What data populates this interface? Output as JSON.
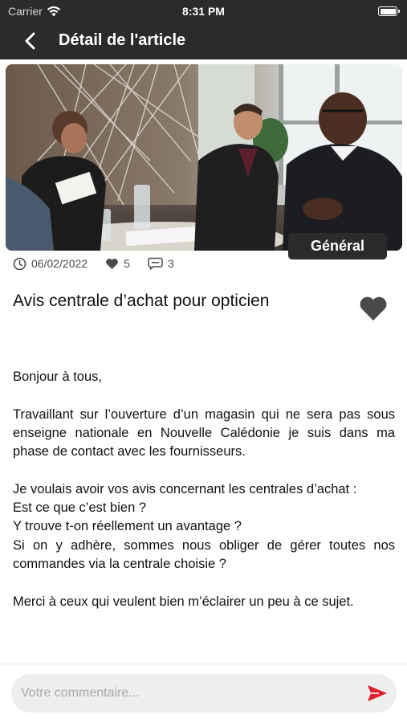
{
  "status_bar": {
    "carrier": "Carrier",
    "time": "8:31 PM",
    "battery_level": 1.0
  },
  "nav": {
    "title": "Détail de l'article",
    "back_icon": "chevron-left-icon"
  },
  "article": {
    "category": "Général",
    "date": "06/02/2022",
    "likes": "5",
    "comments": "3",
    "title": "Avis centrale d’achat pour opticien",
    "paragraphs": [
      [
        "Bonjour à tous,"
      ],
      [
        "Travaillant sur l’ouverture d’un magasin qui ne sera pas sous enseigne nationale en Nouvelle Calédonie je suis dans ma phase de contact avec les fournisseurs."
      ],
      [
        "Je voulais avoir vos avis concernant les centrales d’achat :",
        "Est ce que c’est bien ?",
        "Y trouve t-on réellement un avantage ?",
        "Si on y adhère, sommes nous obliger de gérer toutes nos commandes via la centrale choisie ?"
      ],
      [
        "Merci à ceux qui veulent bien m’éclairer un peu à ce sujet."
      ]
    ]
  },
  "comment": {
    "placeholder": "Votre commentaire...",
    "value": ""
  },
  "colors": {
    "header_bg": "#2b2b2b",
    "send_accent": "#e0202e",
    "favorite": "#4a4a4a"
  }
}
